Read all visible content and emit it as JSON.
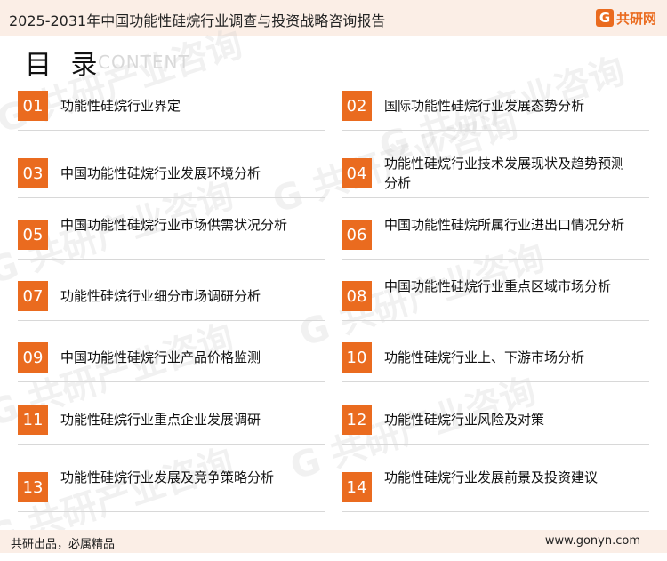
{
  "header": {
    "title": "2025-2031年中国功能性硅烷行业调查与投资战略咨询报告",
    "logo_text": "共研网",
    "logo_icon": "g-logo-icon"
  },
  "toc": {
    "heading": "目 录",
    "heading_en": "CONTENT"
  },
  "watermark_text": "G 共研产业咨询",
  "items": [
    {
      "num": "01",
      "label": "功能性硅烷行业界定"
    },
    {
      "num": "02",
      "label": "国际功能性硅烷行业发展态势分析"
    },
    {
      "num": "03",
      "label": "中国功能性硅烷行业发展环境分析"
    },
    {
      "num": "04",
      "label": "功能性硅烷行业技术发展现状及趋势预测分析"
    },
    {
      "num": "05",
      "label": "中国功能性硅烷行业市场供需状况分析"
    },
    {
      "num": "06",
      "label": "中国功能性硅烷所属行业进出口情况分析"
    },
    {
      "num": "07",
      "label": "功能性硅烷行业细分市场调研分析"
    },
    {
      "num": "08",
      "label": "中国功能性硅烷行业重点区域市场分析"
    },
    {
      "num": "09",
      "label": "中国功能性硅烷行业产品价格监测"
    },
    {
      "num": "10",
      "label": "功能性硅烷行业上、下游市场分析"
    },
    {
      "num": "11",
      "label": "功能性硅烷行业重点企业发展调研"
    },
    {
      "num": "12",
      "label": "功能性硅烷行业风险及对策"
    },
    {
      "num": "13",
      "label": "功能性硅烷行业发展及竞争策略分析"
    },
    {
      "num": "14",
      "label": "功能性硅烷行业发展前景及投资建议"
    }
  ],
  "footer": {
    "slogan": "共研出品，必属精品",
    "url": "www.gonyn.com"
  },
  "colors": {
    "accent": "#ea6b1f",
    "band": "#fbeee6"
  }
}
